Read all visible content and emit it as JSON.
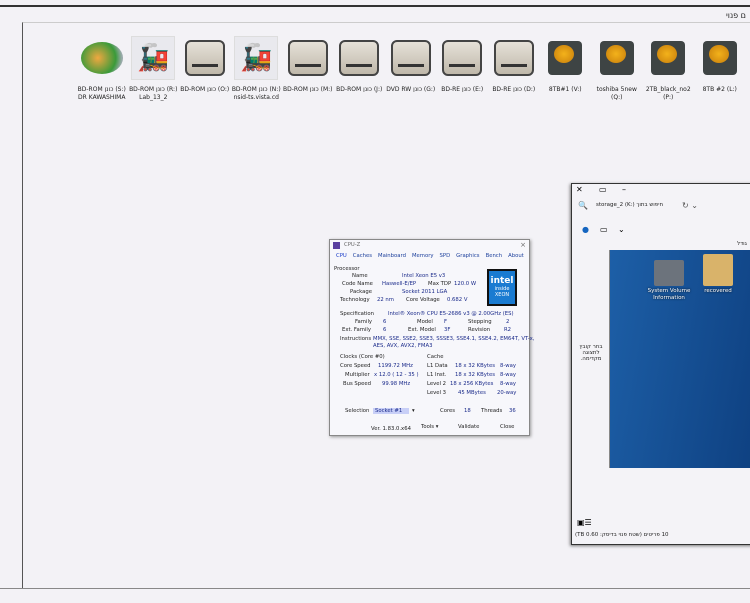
{
  "corner_text": "ם פנוי",
  "drives": [
    {
      "label1": "BD-ROM כונן (S:)",
      "label2": "DR KAWASHIMA",
      "icon": "brain-disc-icon"
    },
    {
      "label1": "BD-ROM כונן (R:)",
      "label2": "Lab_13_2",
      "icon": "train-disc-icon"
    },
    {
      "label1": "BD-ROM כונן (O:)",
      "label2": "",
      "icon": "optical-drive-icon"
    },
    {
      "label1": "BD-ROM כונן (N:)",
      "label2": "nsid-ts.vista.cd",
      "icon": "train-disc-icon"
    },
    {
      "label1": "BD-ROM כונן (M:)",
      "label2": "",
      "icon": "optical-drive-icon"
    },
    {
      "label1": "BD-ROM כונן (J:)",
      "label2": "",
      "icon": "optical-drive-icon"
    },
    {
      "label1": "DVD RW כונן (G:)",
      "label2": "",
      "icon": "optical-drive-icon"
    },
    {
      "label1": "BD-RE כונן (E:)",
      "label2": "",
      "icon": "optical-drive-icon"
    },
    {
      "label1": "BD-RE כונן (D:)",
      "label2": "",
      "icon": "optical-drive-icon"
    },
    {
      "label1": "8TB#1 (V:)",
      "label2": "",
      "icon": "hard-drive-icon"
    },
    {
      "label1": "toshiba 5new (Q:)",
      "label2": "",
      "icon": "hard-drive-icon"
    },
    {
      "label1": "2TB_black_no2 (P:)",
      "label2": "",
      "icon": "hard-drive-icon"
    },
    {
      "label1": "8TB #2 (L:)",
      "label2": "",
      "icon": "hard-drive-icon"
    }
  ],
  "cpuz": {
    "title": "CPU-Z",
    "tabs": [
      "CPU",
      "Caches",
      "Mainboard",
      "Memory",
      "SPD",
      "Graphics",
      "Bench",
      "About"
    ],
    "processor": "Processor",
    "name_l": "Name",
    "name": "Intel Xeon E5 v3",
    "codename_l": "Code Name",
    "codename": "Haswell-E/EP",
    "maxtdp_l": "Max TDP",
    "maxtdp": "120.0 W",
    "package_l": "Package",
    "package": "Socket 2011 LGA",
    "tech_l": "Technology",
    "tech": "22 nm",
    "voltage_l": "Core Voltage",
    "voltage": "0.682 V",
    "spec_l": "Specification",
    "spec": "Intel® Xeon® CPU E5-2686 v3 @ 2.00GHz (ES)",
    "family_l": "Family",
    "family": "6",
    "model_l": "Model",
    "model": "F",
    "stepping_l": "Stepping",
    "stepping": "2",
    "extfamily_l": "Ext. Family",
    "extfamily": "6",
    "extmodel_l": "Ext. Model",
    "extmodel": "3F",
    "revision_l": "Revision",
    "revision": "R2",
    "instr_l": "Instructions",
    "instr1": "MMX, SSE, SSE2, SSE3, SSSE3, SSE4.1, SSE4.2, EM64T, VT-x,",
    "instr2": "AES, AVX, AVX2, FMA3",
    "clocks_l": "Clocks (Core #0)",
    "corespeed_l": "Core Speed",
    "corespeed": "1199.72 MHz",
    "mult_l": "Multiplier",
    "mult": "x 12.0 ( 12 - 35 )",
    "bus_l": "Bus Speed",
    "bus": "99.98 MHz",
    "cache_l": "Cache",
    "l1d_l": "L1 Data",
    "l1d": "18 x 32 KBytes",
    "l1d_w": "8-way",
    "l1i_l": "L1 Inst.",
    "l1i": "18 x 32 KBytes",
    "l1i_w": "8-way",
    "l2_l": "Level 2",
    "l2": "18 x 256 KBytes",
    "l2_w": "8-way",
    "l3_l": "Level 3",
    "l3": "45 MBytes",
    "l3_w": "20-way",
    "selection_l": "Selection",
    "selection": "Socket #1",
    "cores_l": "Cores",
    "cores": "18",
    "threads_l": "Threads",
    "threads": "36",
    "version": "Ver. 1.83.0.x64",
    "tools": "Tools",
    "validate": "Validate",
    "close": "Close",
    "intel_brand": "intel",
    "intel_inside": "inside",
    "intel_xeon": "XEON"
  },
  "explorer": {
    "search": "חיפוש בתוך storage_2 (K:)",
    "column": "גודל",
    "preview": "בחר קובץ לתצוגה מקדימה.",
    "folders": [
      {
        "name": "System Volume Information"
      },
      {
        "name": "recovered"
      }
    ],
    "status": "10 פריטים (שטח פנוי בדיסק: 0.60 TB)"
  }
}
